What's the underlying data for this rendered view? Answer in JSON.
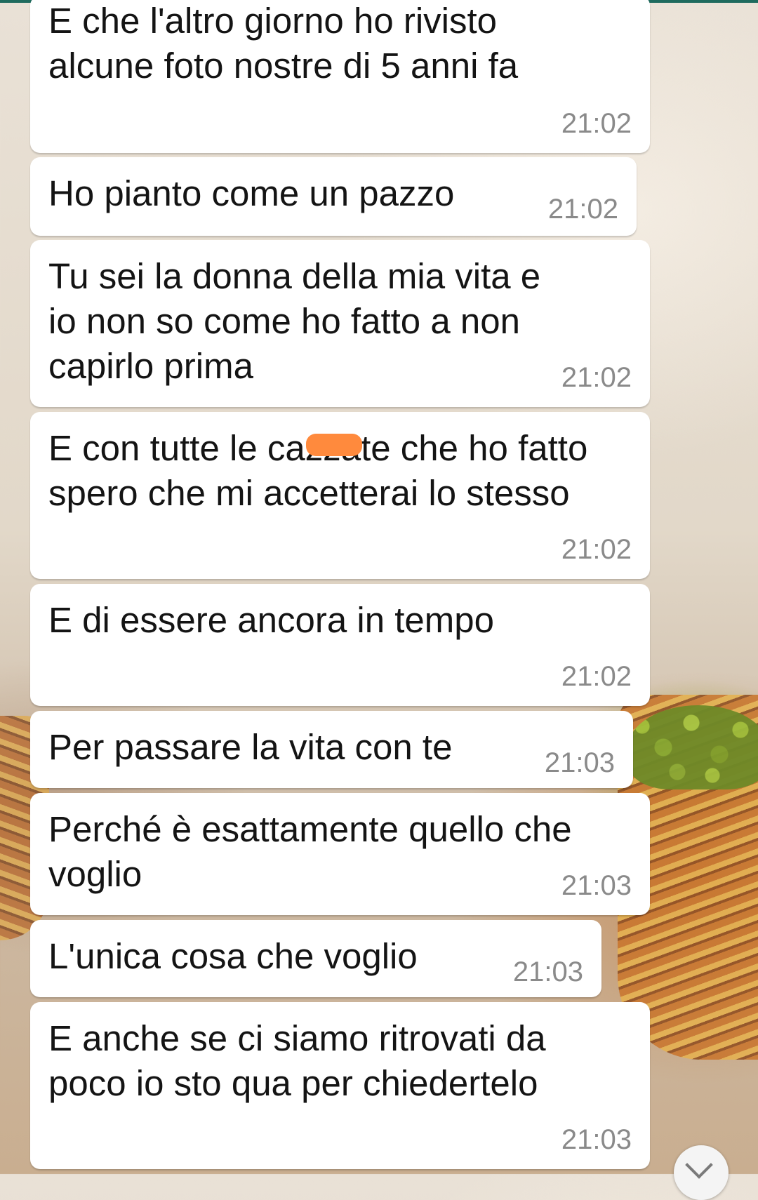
{
  "chat": {
    "messages": [
      {
        "text": "E che l'altro giorno ho rivisto\nalcune foto nostre di 5 anni fa",
        "time": "21:02"
      },
      {
        "text": "Ho pianto come un pazzo",
        "time": "21:02"
      },
      {
        "text": "Tu sei la donna della mia vita e\nio non so come ho fatto a non\ncapirlo prima",
        "time": "21:02"
      },
      {
        "text": "E con tutte le cazzate che ho fatto\nspero che mi accetterai lo stesso",
        "time": "21:02"
      },
      {
        "text": "E di essere ancora in tempo",
        "time": "21:02"
      },
      {
        "text": "Per passare la vita con te",
        "time": "21:03"
      },
      {
        "text": "Perché è esattamente quello che\nvoglio",
        "time": "21:03"
      },
      {
        "text": "L'unica cosa che voglio",
        "time": "21:03"
      },
      {
        "text": "E anche se ci siamo ritrovati da\npoco io sto qua per chiedertelo",
        "time": "21:03"
      }
    ]
  },
  "icons": {
    "scroll_down": "chevron-down-icon"
  }
}
